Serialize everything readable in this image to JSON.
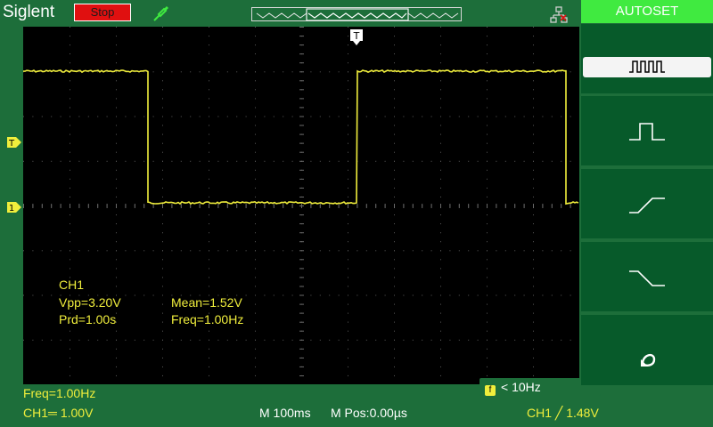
{
  "header": {
    "brand": "Siglent",
    "run_state": "Stop"
  },
  "menu": {
    "title": "AUTOSET",
    "items": [
      {
        "icon": "multi-cycle-square-icon",
        "selected": true
      },
      {
        "icon": "single-cycle-pulse-icon"
      },
      {
        "icon": "rising-edge-icon"
      },
      {
        "icon": "falling-edge-icon"
      },
      {
        "icon": "undo-arrow-icon"
      }
    ]
  },
  "markers": {
    "trigger_level": "T",
    "channel1": "1",
    "trigger_position": "T"
  },
  "measurements": {
    "channel": "CH1",
    "vpp": "Vpp=3.20V",
    "mean": "Mean=1.52V",
    "period": "Prd=1.00s",
    "freq": "Freq=1.00Hz"
  },
  "freq_indicator": {
    "icon": "f",
    "text": "< 10Hz"
  },
  "status": {
    "freq": "Freq=1.00Hz",
    "ch1_scale": "CH1═ 1.00V",
    "timebase": "M 100ms",
    "mpos": "M Pos:0.00µs",
    "trigger": "CH1 ╱ 1.48V"
  },
  "colors": {
    "trace": "#f0ee3c",
    "background": "#1d6e3a",
    "menu_title": "#40ea40",
    "menu_item": "#075a2a",
    "stop_button": "#e01010"
  },
  "waveform": {
    "type": "square",
    "high_v": 3.2,
    "low_v": 0.0,
    "period_s": 1.0,
    "duty": 0.5
  }
}
